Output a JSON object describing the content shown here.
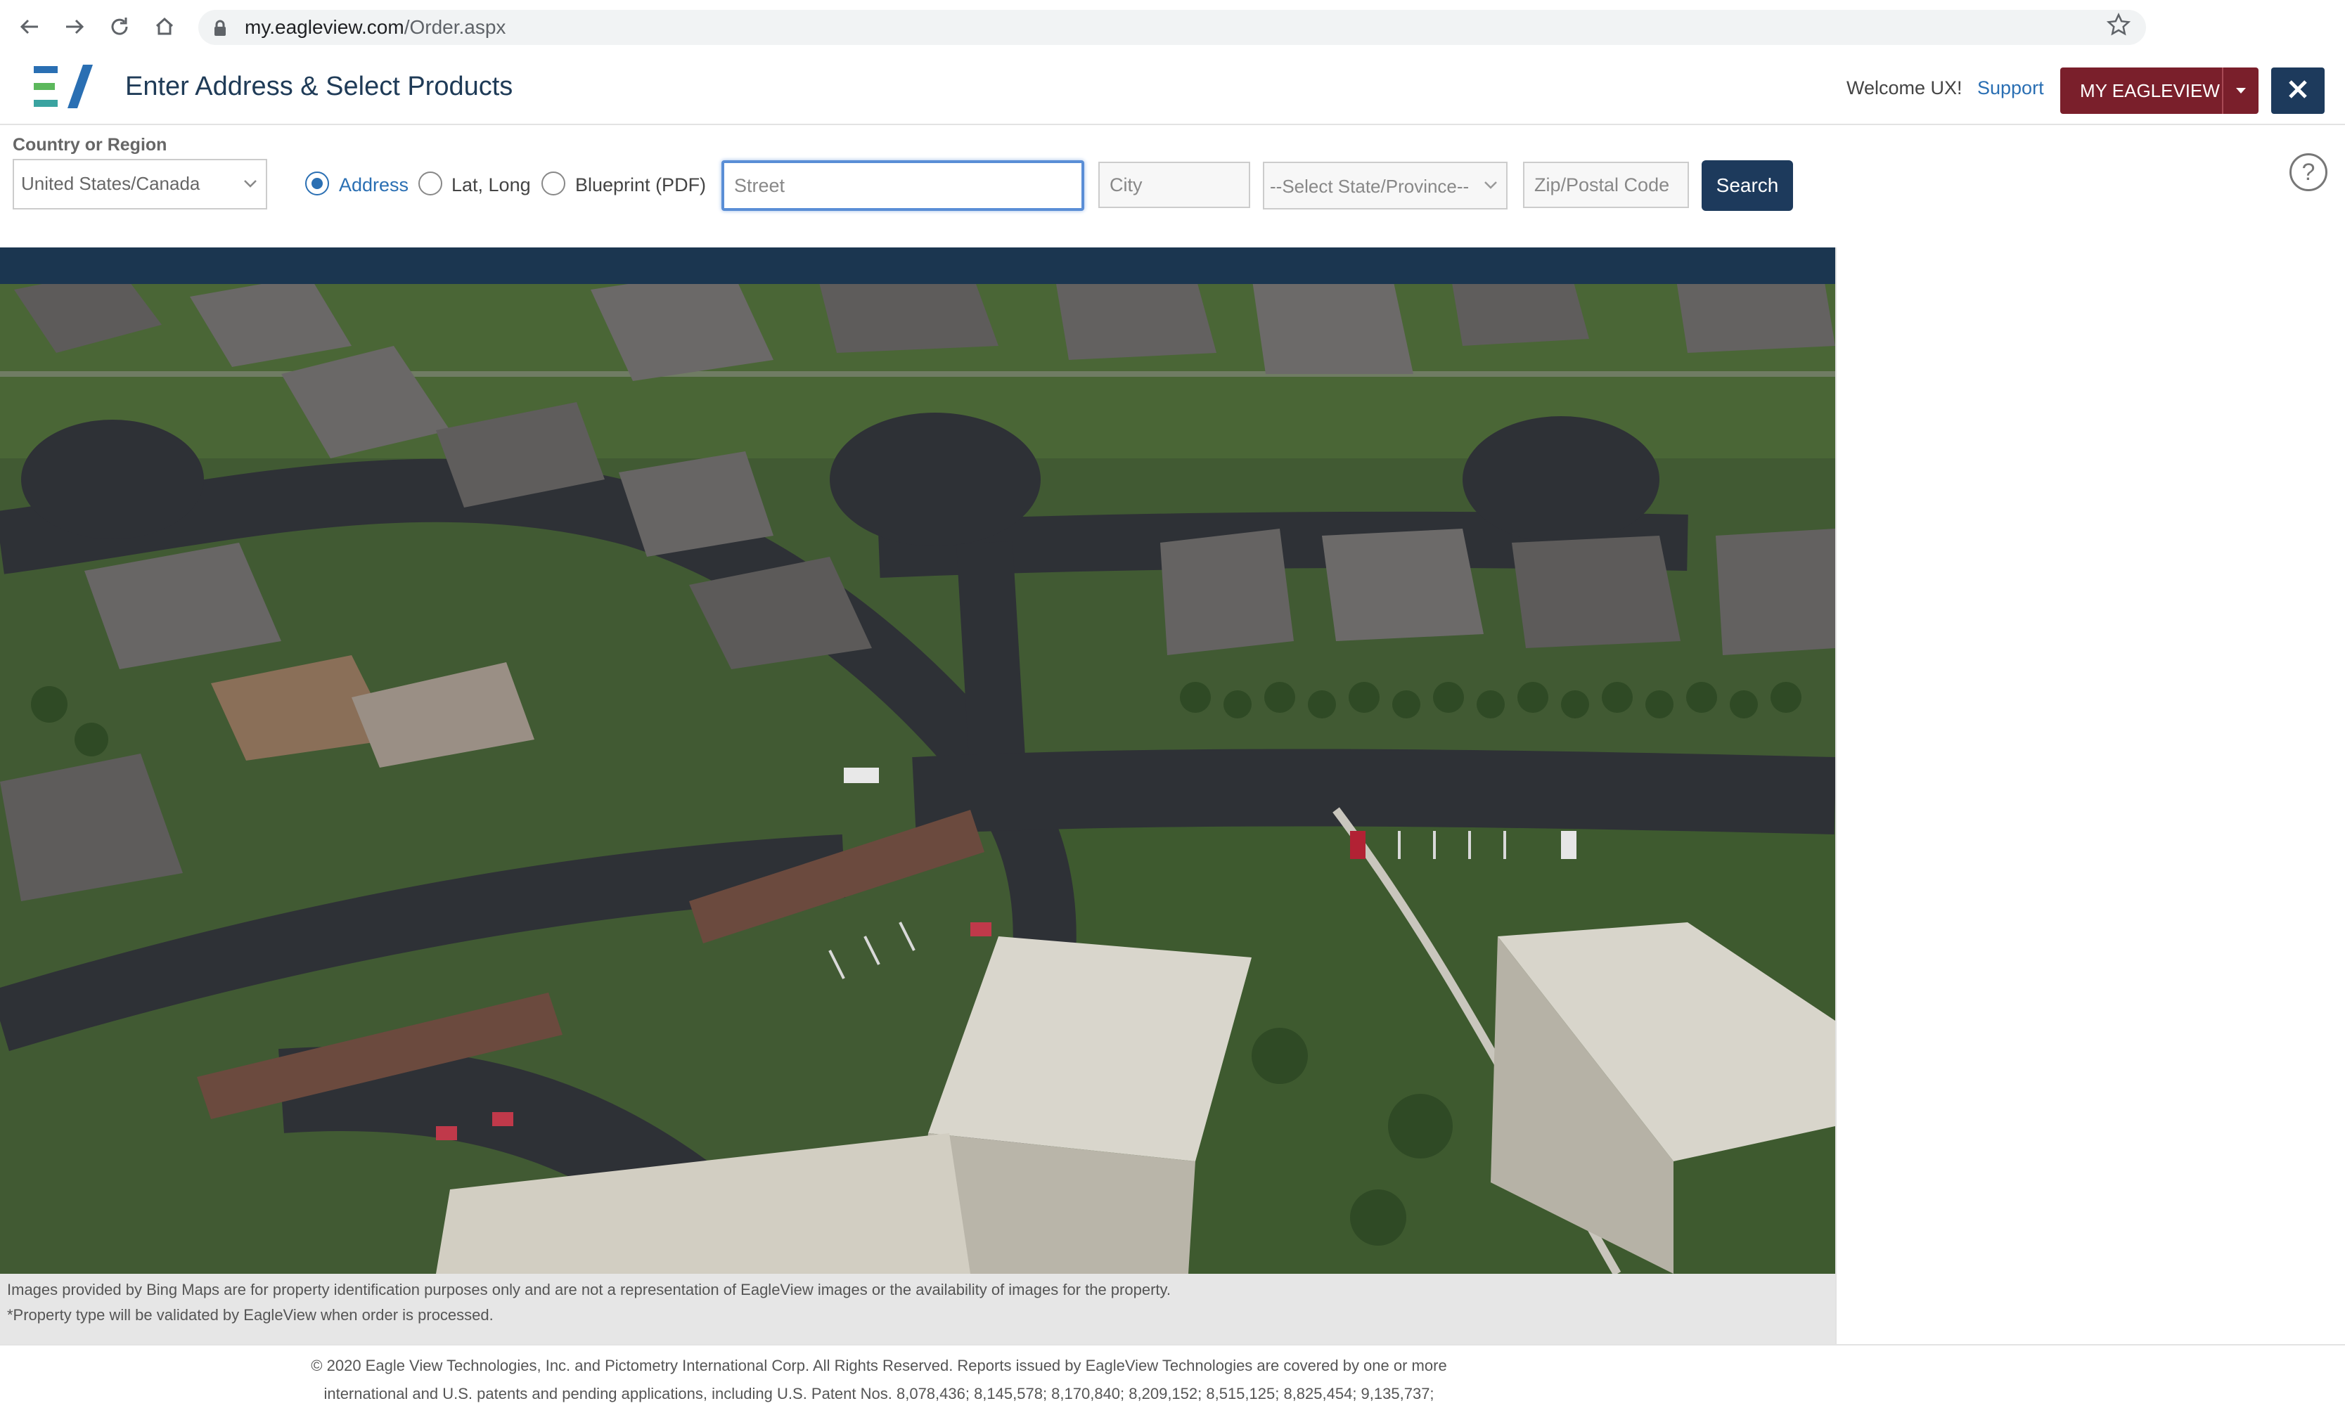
{
  "browser": {
    "url_host": "my.eagleview.com",
    "url_path": "/Order.aspx"
  },
  "header": {
    "title": "Enter Address & Select Products",
    "welcome": "Welcome UX!",
    "support_label": "Support",
    "my_eagleview_label": "MY EAGLEVIEW"
  },
  "search": {
    "country_label": "Country or Region",
    "country_value": "United States/Canada",
    "mode_options": [
      "Address",
      "Lat, Long",
      "Blueprint (PDF)"
    ],
    "selected_mode": "Address",
    "street_placeholder": "Street",
    "city_placeholder": "City",
    "state_placeholder": "--Select State/Province--",
    "zip_placeholder": "Zip/Postal Code",
    "search_label": "Search"
  },
  "map": {
    "disclaimer": "Images provided by Bing Maps are for property identification purposes only and are not a representation of EagleView images or the availability of images for the property.",
    "property_note": "*Property type will be validated by EagleView when order is processed."
  },
  "footer": {
    "line1": "© 2020 Eagle View Technologies, Inc. and Pictometry International Corp. All Rights Reserved. Reports issued by EagleView Technologies are covered by one or more",
    "line2": "international and U.S. patents and pending applications, including U.S. Patent Nos. 8,078,436; 8,145,578; 8,170,840; 8,209,152; 8,515,125; 8,825,454; 9,135,737;"
  },
  "icons": [
    "back-icon",
    "forward-icon",
    "reload-icon",
    "home-icon",
    "lock-icon",
    "star-icon",
    "chevron-down-icon",
    "close-icon",
    "help-icon"
  ],
  "colors": {
    "brand_navy": "#1d3a5c",
    "brand_maroon": "#7a1f2b",
    "link_blue": "#2a6fb3"
  }
}
